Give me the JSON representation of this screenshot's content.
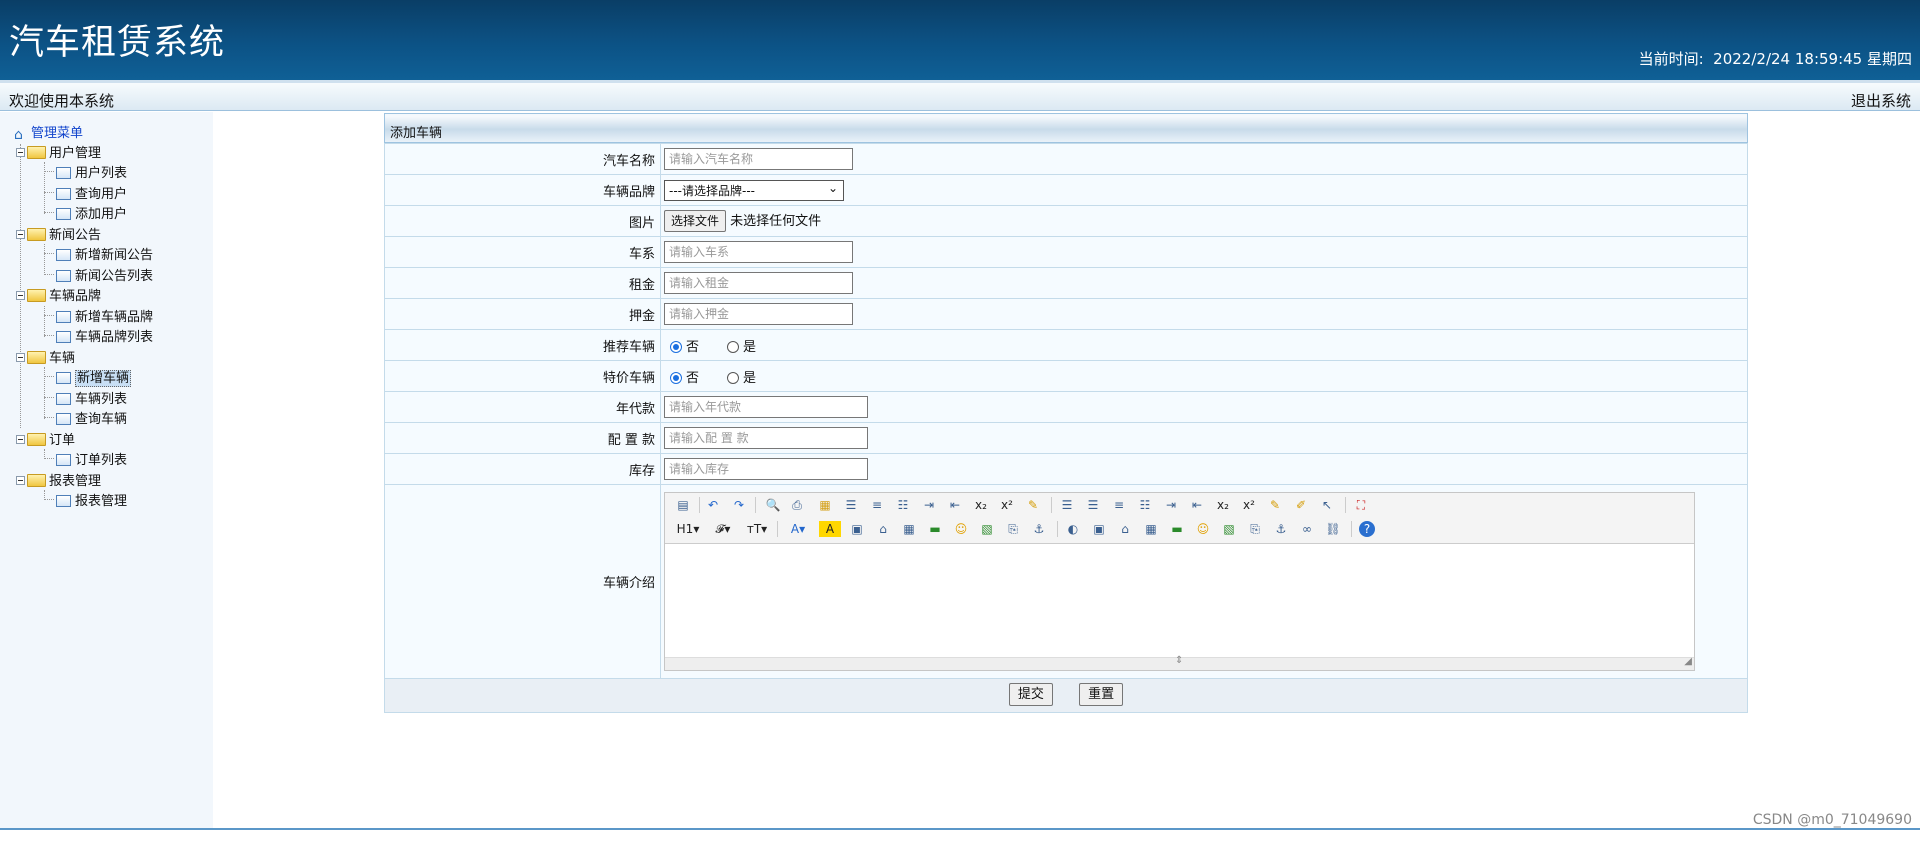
{
  "header": {
    "title": "汽车租赁系统",
    "time_label": "当前时间:",
    "time_value": "2022/2/24 18:59:45 星期四"
  },
  "subbar": {
    "welcome": "欢迎使用本系统",
    "logout": "退出系统"
  },
  "menu": {
    "root": "管理菜单",
    "groups": [
      {
        "label": "用户管理",
        "items": [
          "用户列表",
          "查询用户",
          "添加用户"
        ]
      },
      {
        "label": "新闻公告",
        "items": [
          "新增新闻公告",
          "新闻公告列表"
        ]
      },
      {
        "label": "车辆品牌",
        "items": [
          "新增车辆品牌",
          "车辆品牌列表"
        ]
      },
      {
        "label": "车辆",
        "items": [
          "新增车辆",
          "车辆列表",
          "查询车辆"
        ]
      },
      {
        "label": "订单",
        "items": [
          "订单列表"
        ]
      },
      {
        "label": "报表管理",
        "items": [
          "报表管理"
        ]
      }
    ],
    "selected": "新增车辆"
  },
  "form": {
    "panel_title": "添加车辆",
    "fields": {
      "name": {
        "label": "汽车名称",
        "placeholder": "请输入汽车名称"
      },
      "brand": {
        "label": "车辆品牌",
        "value": "---请选择品牌---"
      },
      "image": {
        "label": "图片",
        "button": "选择文件",
        "status": "未选择任何文件"
      },
      "series": {
        "label": "车系",
        "placeholder": "请输入车系"
      },
      "rent": {
        "label": "租金",
        "placeholder": "请输入租金"
      },
      "deposit": {
        "label": "押金",
        "placeholder": "请输入押金"
      },
      "recommend": {
        "label": "推荐车辆",
        "opt_no": "否",
        "opt_yes": "是"
      },
      "special": {
        "label": "特价车辆",
        "opt_no": "否",
        "opt_yes": "是"
      },
      "year": {
        "label": "年代款",
        "placeholder": "请输入年代款"
      },
      "config": {
        "label": "配 置 款",
        "placeholder": "请输入配 置 款"
      },
      "stock": {
        "label": "库存",
        "placeholder": "请输入库存"
      },
      "intro": {
        "label": "车辆介绍"
      }
    },
    "submit": "提交",
    "reset": "重置"
  },
  "footer_text": "",
  "watermark": "CSDN @m0_71049690"
}
